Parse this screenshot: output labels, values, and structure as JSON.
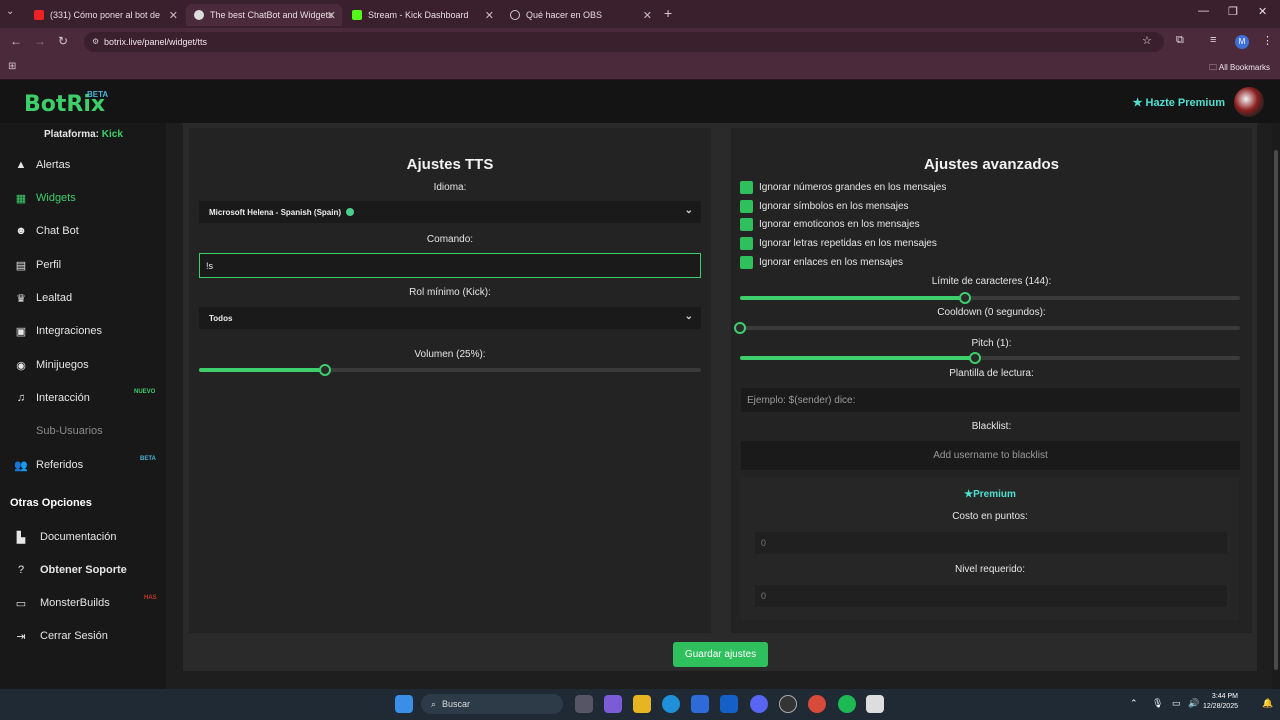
{
  "browser": {
    "tabs": [
      {
        "title": "(331) Cómo poner al bot de",
        "active": false
      },
      {
        "title": "The best ChatBot and Widgets",
        "active": true
      },
      {
        "title": "Stream - Kick Dashboard",
        "active": false
      },
      {
        "title": "Qué hacer en OBS",
        "active": false
      }
    ],
    "url": "botrix.live/panel/widget/tts",
    "bookmarks_label": "All Bookmarks",
    "profile_initial": "M"
  },
  "app": {
    "logo": "BotRix",
    "logo_badge": "BETA",
    "premium_link": "Hazte Premium",
    "platform_label": "Plataforma:",
    "platform_value": "Kick"
  },
  "sidebar": {
    "items": [
      {
        "label": "Alertas",
        "icon": "warning-icon"
      },
      {
        "label": "Widgets",
        "icon": "widgets-icon",
        "active": true
      },
      {
        "label": "Chat Bot",
        "icon": "robot-icon"
      },
      {
        "label": "Perfil",
        "icon": "id-card-icon"
      },
      {
        "label": "Lealtad",
        "icon": "trophy-icon"
      },
      {
        "label": "Integraciones",
        "icon": "integrations-icon"
      },
      {
        "label": "Minijuegos",
        "icon": "gamepad-icon"
      },
      {
        "label": "Interacción",
        "icon": "music-icon",
        "badge": "NUEVO"
      },
      {
        "label": "Sub-Usuarios",
        "icon": "",
        "disabled": true
      },
      {
        "label": "Referidos",
        "icon": "users-icon",
        "badge": "BETA"
      }
    ],
    "other_header": "Otras Opciones",
    "other_items": [
      {
        "label": "Documentación",
        "icon": "docs-icon"
      },
      {
        "label": "Obtener Soporte",
        "icon": "help-icon"
      },
      {
        "label": "MonsterBuilds",
        "icon": "laptop-icon",
        "badge": "HAS"
      },
      {
        "label": "Cerrar Sesión",
        "icon": "logout-icon"
      }
    ]
  },
  "tts": {
    "title": "Ajustes TTS",
    "language_label": "Idioma:",
    "language_value": "Microsoft Helena - Spanish (Spain)",
    "command_label": "Comando:",
    "command_value": "!s",
    "role_label": "Rol mínimo (Kick):",
    "role_value": "Todos",
    "volume_label": "Volumen (25%):",
    "volume_value": 0.25
  },
  "advanced": {
    "title": "Ajustes avanzados",
    "checkboxes": [
      "Ignorar números grandes en los mensajes",
      "Ignorar símbolos en los mensajes",
      "Ignorar emoticonos en los mensajes",
      "Ignorar letras repetidas en los mensajes",
      "Ignorar enlaces en los mensajes"
    ],
    "char_limit_label": "Límite de caracteres (144):",
    "char_limit_value": 0.45,
    "cooldown_label": "Cooldown (0 segundos):",
    "cooldown_value": 0,
    "pitch_label": "Pitch (1):",
    "pitch_value": 0.47,
    "template_label": "Plantilla de lectura:",
    "template_placeholder": "Ejemplo: $(sender) dice:",
    "blacklist_label": "Blacklist:",
    "blacklist_placeholder": "Add username to blacklist",
    "premium_title": "Premium",
    "cost_label": "Costo en puntos:",
    "cost_value": "0",
    "level_label": "Nivel requerido:",
    "level_value": "0"
  },
  "actions": {
    "save_label": "Guardar ajustes"
  },
  "taskbar": {
    "search_label": "Buscar",
    "time": "3:44 PM",
    "date": "12/28/2025"
  },
  "colors": {
    "accent": "#3ccf6a",
    "premium": "#4ee0d2"
  }
}
